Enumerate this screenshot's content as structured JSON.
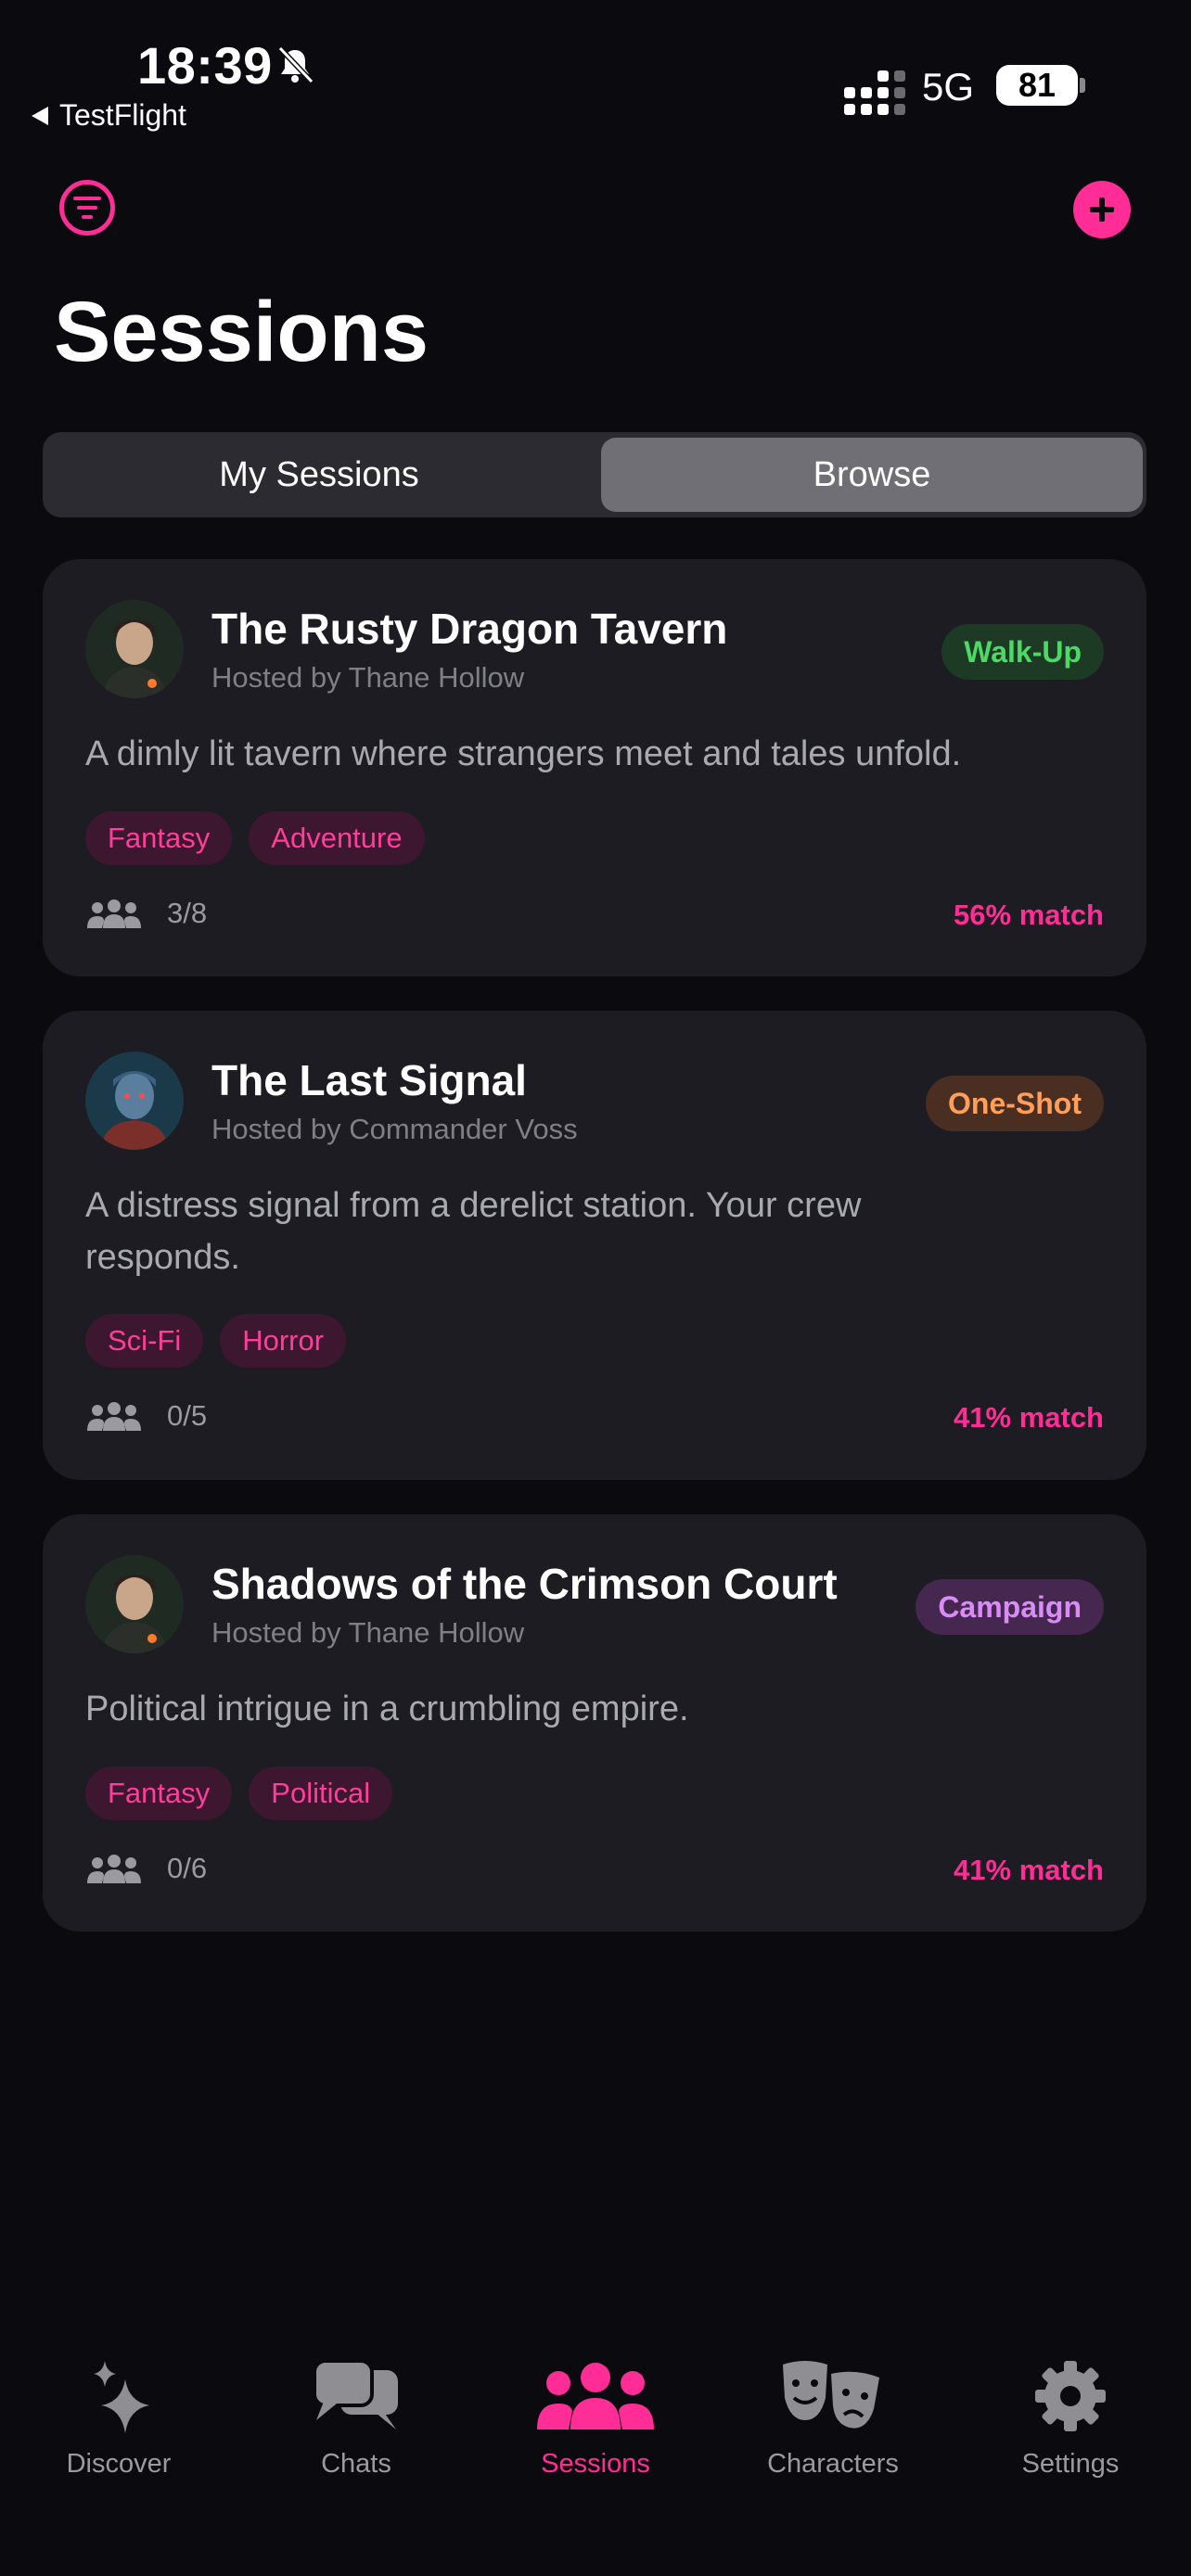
{
  "status_bar": {
    "time": "18:39",
    "back_label": "TestFlight",
    "network": "5G",
    "battery": "81"
  },
  "header": {
    "title": "Sessions"
  },
  "segments": {
    "left": "My Sessions",
    "right": "Browse"
  },
  "sessions": [
    {
      "title": "The Rusty Dragon Tavern",
      "host": "Hosted by Thane Hollow",
      "badge": "Walk-Up",
      "description": "A dimly lit tavern where strangers meet and tales unfold.",
      "tags": [
        "Fantasy",
        "Adventure"
      ],
      "players": "3/8",
      "match": "56% match"
    },
    {
      "title": "The Last Signal",
      "host": "Hosted by Commander Voss",
      "badge": "One-Shot",
      "description": "A distress signal from a derelict station. Your crew responds.",
      "tags": [
        "Sci-Fi",
        "Horror"
      ],
      "players": "0/5",
      "match": "41% match"
    },
    {
      "title": "Shadows of the Crimson Court",
      "host": "Hosted by Thane Hollow",
      "badge": "Campaign",
      "description": "Political intrigue in a crumbling empire.",
      "tags": [
        "Fantasy",
        "Political"
      ],
      "players": "0/6",
      "match": "41% match"
    }
  ],
  "tabs": [
    {
      "label": "Discover",
      "icon": "sparkles-icon"
    },
    {
      "label": "Chats",
      "icon": "chat-bubbles-icon"
    },
    {
      "label": "Sessions",
      "icon": "people-icon"
    },
    {
      "label": "Characters",
      "icon": "theater-masks-icon"
    },
    {
      "label": "Settings",
      "icon": "gear-icon"
    }
  ],
  "colors": {
    "accent": "#ff2d95",
    "background": "#0b0b0f",
    "card": "#1c1c22",
    "walkup": "#4cd964",
    "oneshot": "#ff9f5a",
    "campaign": "#d98cf5"
  }
}
